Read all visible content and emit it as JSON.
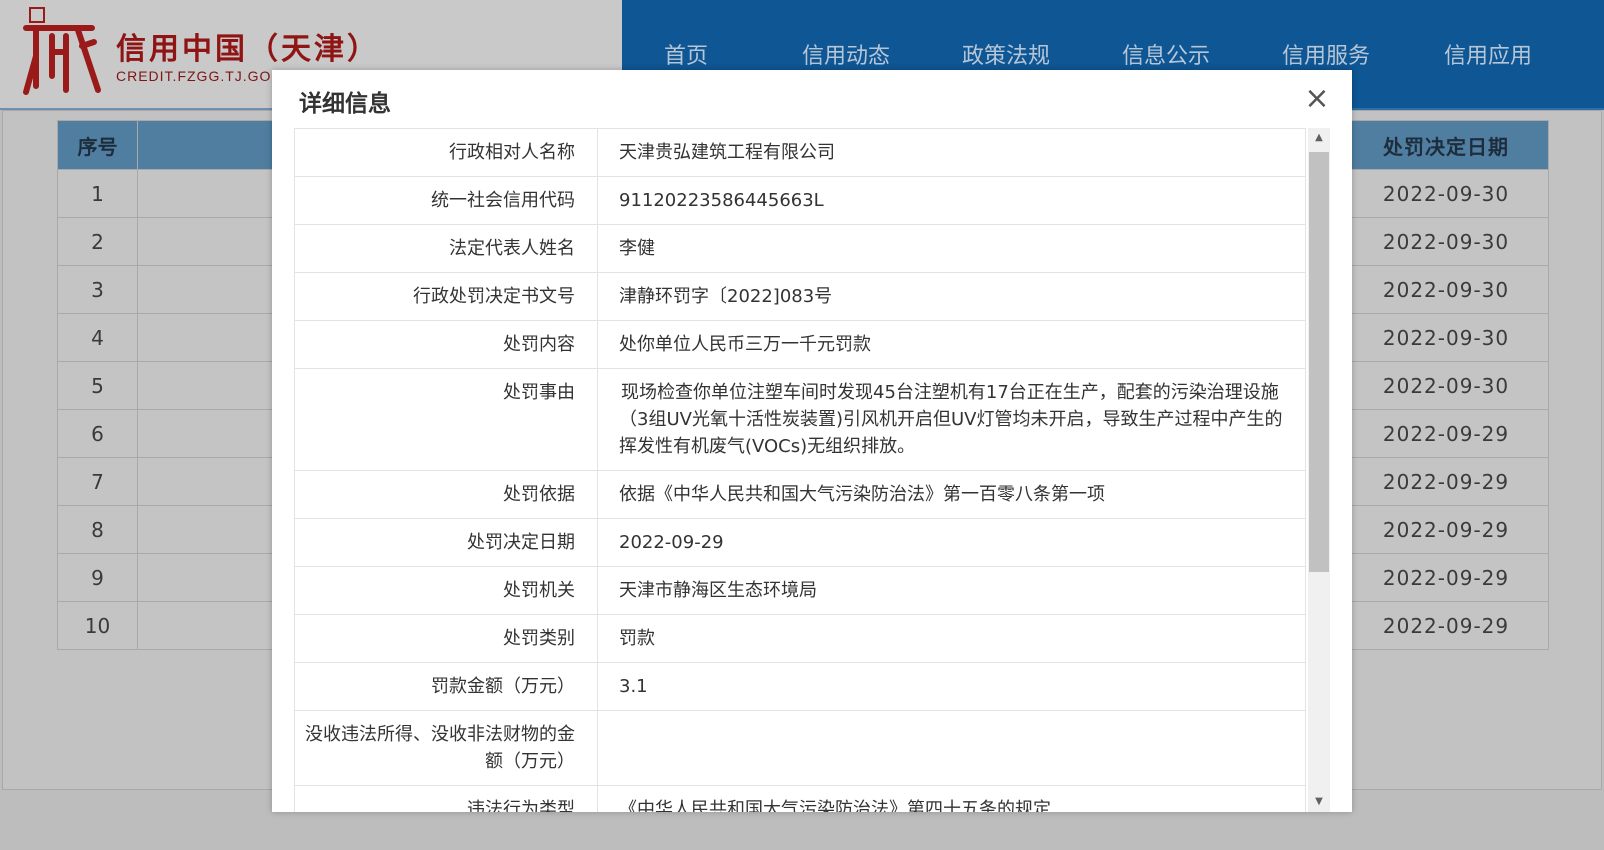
{
  "header": {
    "logo_title": "信用中国（天津）",
    "logo_url": "CREDIT.FZGG.TJ.GO",
    "logo_color": "#8f1414",
    "nav": [
      "首页",
      "信用动态",
      "政策法规",
      "信息公示",
      "信用服务",
      "信用应用"
    ]
  },
  "list_table": {
    "headers": {
      "seq": "序号",
      "date": "处罚决定日期"
    },
    "rows": [
      {
        "seq": "1",
        "date": "2022-09-30"
      },
      {
        "seq": "2",
        "date": "2022-09-30"
      },
      {
        "seq": "3",
        "date": "2022-09-30"
      },
      {
        "seq": "4",
        "date": "2022-09-30"
      },
      {
        "seq": "5",
        "date": "2022-09-30"
      },
      {
        "seq": "6",
        "date": "2022-09-29"
      },
      {
        "seq": "7",
        "date": "2022-09-29"
      },
      {
        "seq": "8",
        "date": "2022-09-29"
      },
      {
        "seq": "9",
        "date": "2022-09-29"
      },
      {
        "seq": "10",
        "date": "2022-09-29"
      }
    ]
  },
  "modal": {
    "title": "详细信息",
    "close_symbol": "×",
    "fields": [
      {
        "label": "行政相对人名称",
        "value": "天津贵弘建筑工程有限公司"
      },
      {
        "label": "统一社会信用代码",
        "value": "91120223586445663L"
      },
      {
        "label": "法定代表人姓名",
        "value": "李健"
      },
      {
        "label": "行政处罚决定书文号",
        "value": "津静环罚字〔2022]083号"
      },
      {
        "label": "处罚内容",
        "value": "处你单位人民币三万一千元罚款"
      },
      {
        "label": "处罚事由",
        "value": "现场检查你单位注塑车间时发现45台注塑机有17台正在生产，配套的污染治理设施（3组UV光氧十活性炭装置)引风机开启但UV灯管均未开启，导致生产过程中产生的挥发性有机废气(VOCs)无组织排放。"
      },
      {
        "label": "处罚依据",
        "value": "依据《中华人民共和国大气污染防治法》第一百零八条第一项"
      },
      {
        "label": "处罚决定日期",
        "value": "2022-09-29"
      },
      {
        "label": "处罚机关",
        "value": "天津市静海区生态环境局"
      },
      {
        "label": "处罚类别",
        "value": "罚款"
      },
      {
        "label": "罚款金额（万元）",
        "value": "3.1"
      },
      {
        "label": "没收违法所得、没收非法财物的金额（万元）",
        "value": ""
      },
      {
        "label": "违法行为类型",
        "value": "《中华人民共和国大气污染防治法》第四十五条的规定"
      }
    ]
  }
}
